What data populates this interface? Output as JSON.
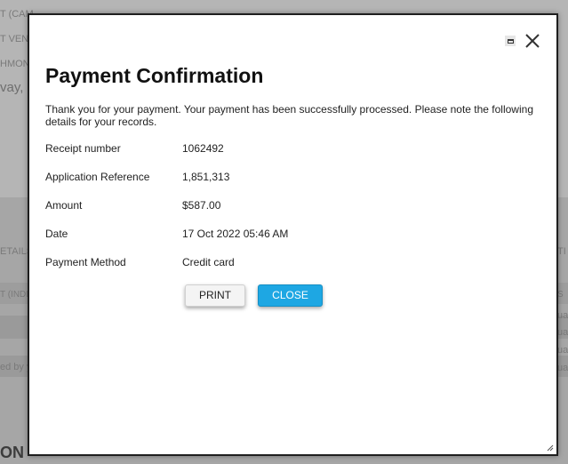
{
  "background": {
    "fragments": [
      "T (CAM",
      "T VEN",
      "HMON",
      "vay, In",
      "ETAILS",
      "T (INDIC",
      "ed by y",
      "ON"
    ],
    "right_fragments": [
      "TI",
      "S",
      "ua",
      "ua",
      "ua",
      "ua"
    ]
  },
  "modal": {
    "title": "Payment Confirmation",
    "message": "Thank you for your payment. Your payment has been successfully processed. Please note the following details for your records.",
    "details": [
      {
        "label": "Receipt number",
        "value": "1062492"
      },
      {
        "label": "Application Reference",
        "value": "1,851,313"
      },
      {
        "label": "Amount",
        "value": "$587.00"
      },
      {
        "label": "Date",
        "value": "17 Oct 2022 05:46 AM"
      },
      {
        "label": "Payment Method",
        "value": "Credit card"
      }
    ],
    "buttons": {
      "print": "PRINT",
      "close": "CLOSE"
    },
    "icons": {
      "maximize": "maximize-icon",
      "close": "close-icon",
      "resize": "resize-grip-icon"
    }
  },
  "colors": {
    "accent": "#1ea7e3",
    "overlay": "#8c8c8c"
  }
}
